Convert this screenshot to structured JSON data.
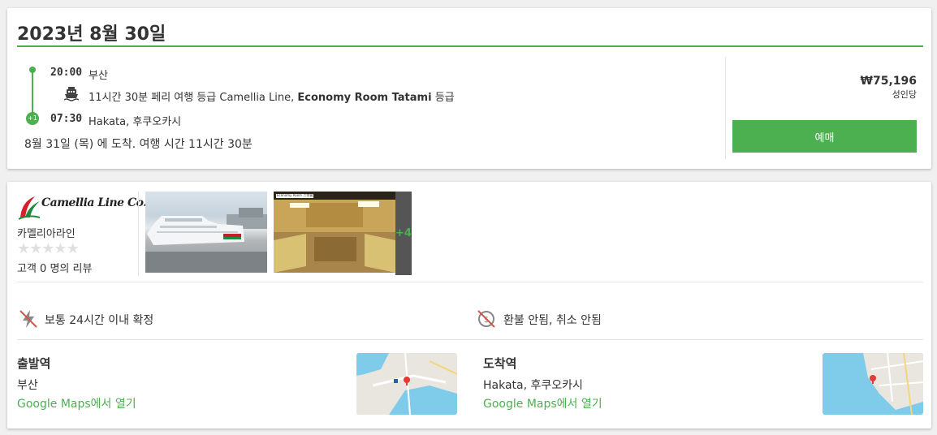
{
  "trip": {
    "date_title": "2023년 8월 30일",
    "departure_time": "20:00",
    "departure_place": "부산",
    "duration_text": "11시간 30분 페리 여행 등급 Camellia Line,",
    "class_name": "Economy Room Tatami",
    "class_suffix": "등급",
    "arrival_time": "07:30",
    "arrival_place": "Hakata, 후쿠오카시",
    "next_day_badge": "+1",
    "arrival_summary": "8월 31일 (목) 에 도착. 여행 시간 11시간 30분",
    "icons": {
      "ship": "ship-icon"
    }
  },
  "booking": {
    "price": "₩75,196",
    "per_person": "성인당",
    "book_button": "예매",
    "accent_color": "#4caf50"
  },
  "operator": {
    "logo_text": "Camellia Line Co.,Ltd.",
    "name": "카멜리아라인",
    "rating_stars": 0,
    "rating_max": 5,
    "reviews_text": "고객 0 명의 리뷰",
    "photo_more_badge": "+4",
    "room_photo_caption": "Economy Room 二等客室"
  },
  "features": [
    {
      "icon": "no-instant-confirm-icon",
      "text": "보통 24시간 이내 확정"
    },
    {
      "icon": "no-refund-icon",
      "text": "환불 안됨, 취소 안됨"
    }
  ],
  "stations": {
    "departure": {
      "title": "출발역",
      "name": "부산",
      "maps_link": "Google Maps에서 열기"
    },
    "arrival": {
      "title": "도착역",
      "name": "Hakata, 후쿠오카시",
      "maps_link": "Google Maps에서 열기"
    }
  }
}
